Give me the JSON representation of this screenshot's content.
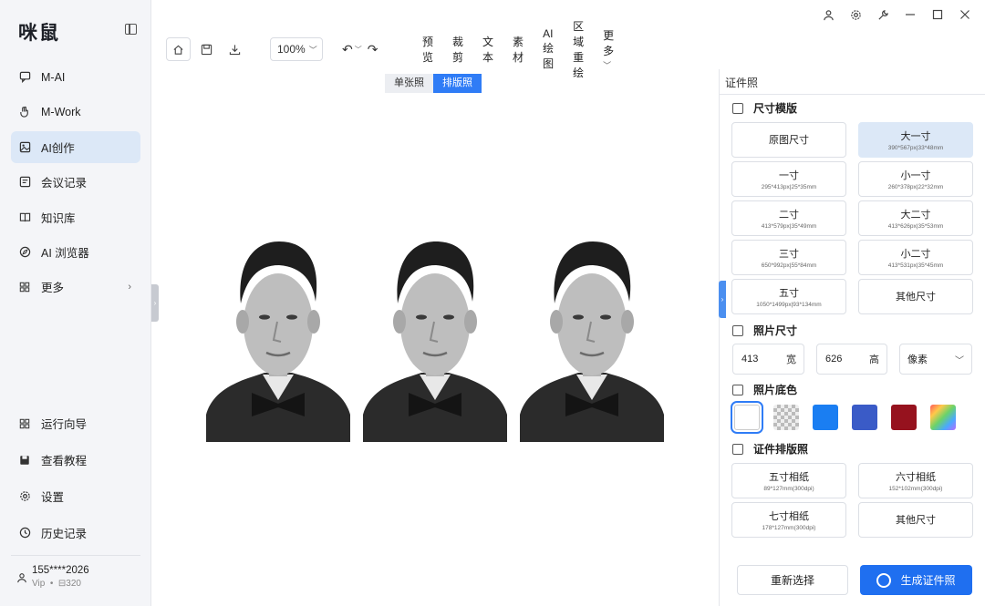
{
  "sidebar": {
    "logo": "咪鼠",
    "items": [
      {
        "label": "M-AI",
        "icon": "chat-icon"
      },
      {
        "label": "M-Work",
        "icon": "hand-icon"
      },
      {
        "label": "AI创作",
        "icon": "image-icon"
      },
      {
        "label": "会议记录",
        "icon": "note-icon"
      },
      {
        "label": "知识库",
        "icon": "book-icon"
      },
      {
        "label": "AI 浏览器",
        "icon": "compass-icon"
      },
      {
        "label": "更多",
        "icon": "grid-icon"
      }
    ],
    "bottom_items": [
      {
        "label": "运行向导",
        "icon": "grid-icon"
      },
      {
        "label": "查看教程",
        "icon": "save-icon"
      },
      {
        "label": "设置",
        "icon": "gear-icon"
      },
      {
        "label": "历史记录",
        "icon": "clock-icon"
      }
    ],
    "user": {
      "name": "155****2026",
      "vip": "Vip",
      "credits": "320"
    }
  },
  "toolbar": {
    "zoom": "100%",
    "menu": [
      "预览",
      "裁剪",
      "文本",
      "素材",
      "AI绘图",
      "区域重绘",
      "更多"
    ]
  },
  "canvas": {
    "toggle": [
      "单张照",
      "排版照"
    ],
    "active_toggle": "排版照"
  },
  "panel": {
    "tab": "证件照",
    "size_template_title": "尺寸模版",
    "sizes": [
      {
        "label": "原图尺寸",
        "sub": ""
      },
      {
        "label": "大一寸",
        "sub": "390*567px|33*48mm"
      },
      {
        "label": "一寸",
        "sub": "295*413px|25*35mm"
      },
      {
        "label": "小一寸",
        "sub": "260*378px|22*32mm"
      },
      {
        "label": "二寸",
        "sub": "413*579px|35*49mm"
      },
      {
        "label": "大二寸",
        "sub": "413*626px|35*53mm"
      },
      {
        "label": "三寸",
        "sub": "650*992px|55*84mm"
      },
      {
        "label": "小二寸",
        "sub": "413*531px|35*45mm"
      },
      {
        "label": "五寸",
        "sub": "1050*1499px|93*134mm"
      },
      {
        "label": "其他尺寸",
        "sub": ""
      }
    ],
    "photo_size_title": "照片尺寸",
    "width": {
      "value": "413",
      "unit": "宽"
    },
    "height": {
      "value": "626",
      "unit": "高"
    },
    "unit_select": "像素",
    "bg_title": "照片底色",
    "bg_colors": [
      "#ffffff",
      "transparent",
      "#1a7ef2",
      "#3a5bc7",
      "#96121e",
      "rainbow"
    ],
    "layout_title": "证件排版照",
    "layouts": [
      {
        "label": "五寸相纸",
        "sub": "89*127mm(300dpi)"
      },
      {
        "label": "六寸相纸",
        "sub": "152*102mm(300dpi)"
      },
      {
        "label": "七寸相纸",
        "sub": "178*127mm(300dpi)"
      },
      {
        "label": "其他尺寸",
        "sub": ""
      }
    ],
    "reset_label": "重新选择",
    "generate_label": "生成证件照"
  }
}
